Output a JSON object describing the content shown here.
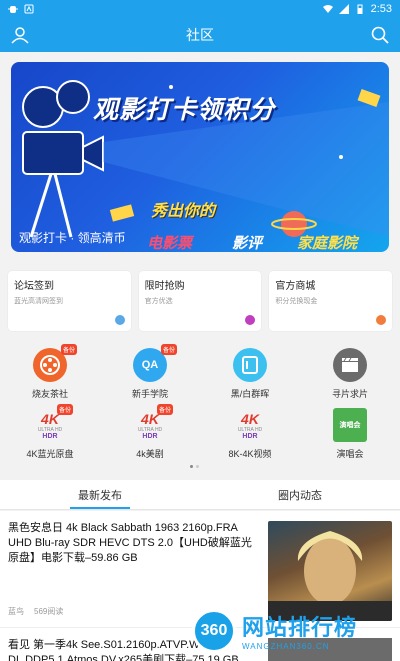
{
  "status_bar": {
    "time": "2:53",
    "icons": [
      "bug-icon",
      "app-notification-icon",
      "wifi-icon",
      "signal-icon",
      "battery-icon"
    ]
  },
  "header": {
    "title": "社区",
    "left_icon": "user-icon",
    "right_icon": "search-icon",
    "color": "#1fa1ec"
  },
  "banner": {
    "headline": "观影打卡领积分",
    "subline": "秀出你的",
    "tags": [
      "电影票",
      "影评",
      "家庭影院"
    ],
    "caption": "观影打卡 · 领高清币"
  },
  "feature_cards": [
    {
      "title": "论坛签到",
      "subtitle": "蓝光高清网签到",
      "badge_color": "#5aa9e6"
    },
    {
      "title": "限时抢购",
      "subtitle": "官方优选",
      "badge_color": "#c03ec0"
    },
    {
      "title": "官方商城",
      "subtitle": "积分兑换现金",
      "badge_color": "#f07d3c"
    }
  ],
  "grid_items": [
    {
      "label": "烧友茶社",
      "icon": "film-reel-icon",
      "badge": "备份",
      "color": "#f0652c"
    },
    {
      "label": "新手学院",
      "icon": "qa-icon",
      "badge": "备份",
      "color": "#2fa8f0",
      "icon_text": "QA"
    },
    {
      "label": "黑/白群晖",
      "icon": "nas-icon",
      "color": "#3cc0f0"
    },
    {
      "label": "寻片求片",
      "icon": "clapperboard-icon",
      "color": "#6b6b6b"
    },
    {
      "label": "4K蓝光原盘",
      "icon": "4k-hdr-logo-icon",
      "badge": "备份"
    },
    {
      "label": "4k美剧",
      "icon": "4k-hdr-logo-icon",
      "badge": "备份"
    },
    {
      "label": "8K-4K视频",
      "icon": "4k-hdr-logo-icon"
    },
    {
      "label": "演唱会",
      "icon": "concert-icon",
      "icon_text": "演唱会",
      "color": "#4caf50"
    }
  ],
  "logo_text": {
    "k": "4K",
    "sub": "ULTRA HD",
    "hdr": "HDR"
  },
  "tabs": [
    {
      "label": "最新发布",
      "active": true
    },
    {
      "label": "圈内动态",
      "active": false
    }
  ],
  "posts": [
    {
      "title": "黑色安息日 4k Black Sabbath 1963 2160p.FRA UHD Blu-ray SDR HEVC DTS 2.0【UHD破解蓝光原盘】电影下载–59.86 GB",
      "author": "蓝鸟",
      "reads": "569阅读"
    },
    {
      "title": "看见 第一季4k See.S01.2160p.ATVP.WEB-DL.DDP5.1.Atmos.DV.x265美剧下载–75.19 GB"
    }
  ],
  "watermark": {
    "logo": "360",
    "title": "网站排行榜",
    "sub": "WANGZHAN360.CN"
  }
}
